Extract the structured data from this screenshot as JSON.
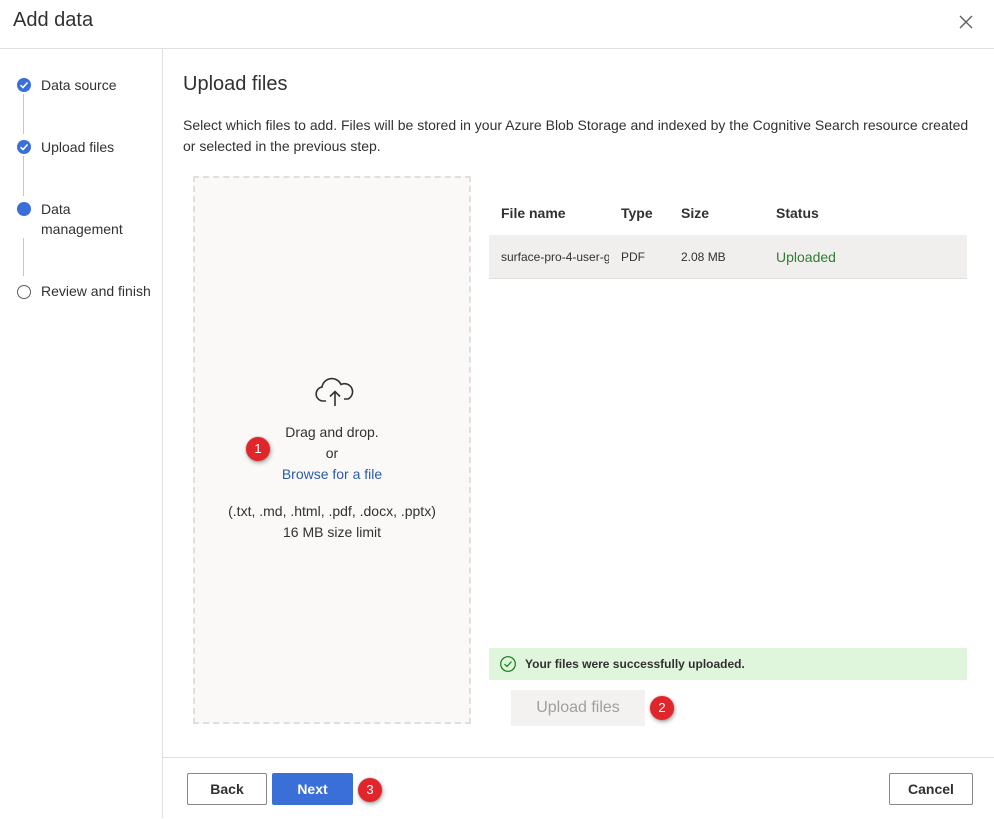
{
  "dialog": {
    "title": "Add data"
  },
  "steps": [
    {
      "label": "Data source",
      "state": "done"
    },
    {
      "label": "Upload files",
      "state": "done"
    },
    {
      "label": "Data management",
      "state": "current"
    },
    {
      "label": "Review and finish",
      "state": "todo"
    }
  ],
  "main": {
    "title": "Upload files",
    "description": "Select which files to add. Files will be stored in your Azure Blob Storage and indexed by the Cognitive Search resource created or selected in the previous step."
  },
  "dropzone": {
    "icon": "cloud-upload-icon",
    "drag_text": "Drag and drop.",
    "or_text": "or",
    "browse_link": "Browse for a file",
    "formats": "(.txt, .md, .html, .pdf, .docx, .pptx)",
    "size_limit": "16 MB size limit"
  },
  "table": {
    "headers": [
      "File name",
      "Type",
      "Size",
      "Status"
    ],
    "rows": [
      {
        "name": "surface-pro-4-user-g",
        "type": "PDF",
        "size": "2.08 MB",
        "status": "Uploaded"
      }
    ]
  },
  "success": {
    "message": "Your files were successfully uploaded."
  },
  "upload_button": "Upload files",
  "badges": [
    "1",
    "2",
    "3"
  ],
  "footer": {
    "back": "Back",
    "next": "Next",
    "cancel": "Cancel"
  },
  "colors": {
    "accent": "#3a6fd8",
    "success_bg": "#dff6dd",
    "status_ok": "#2e7d32",
    "badge": "#e0262a"
  }
}
